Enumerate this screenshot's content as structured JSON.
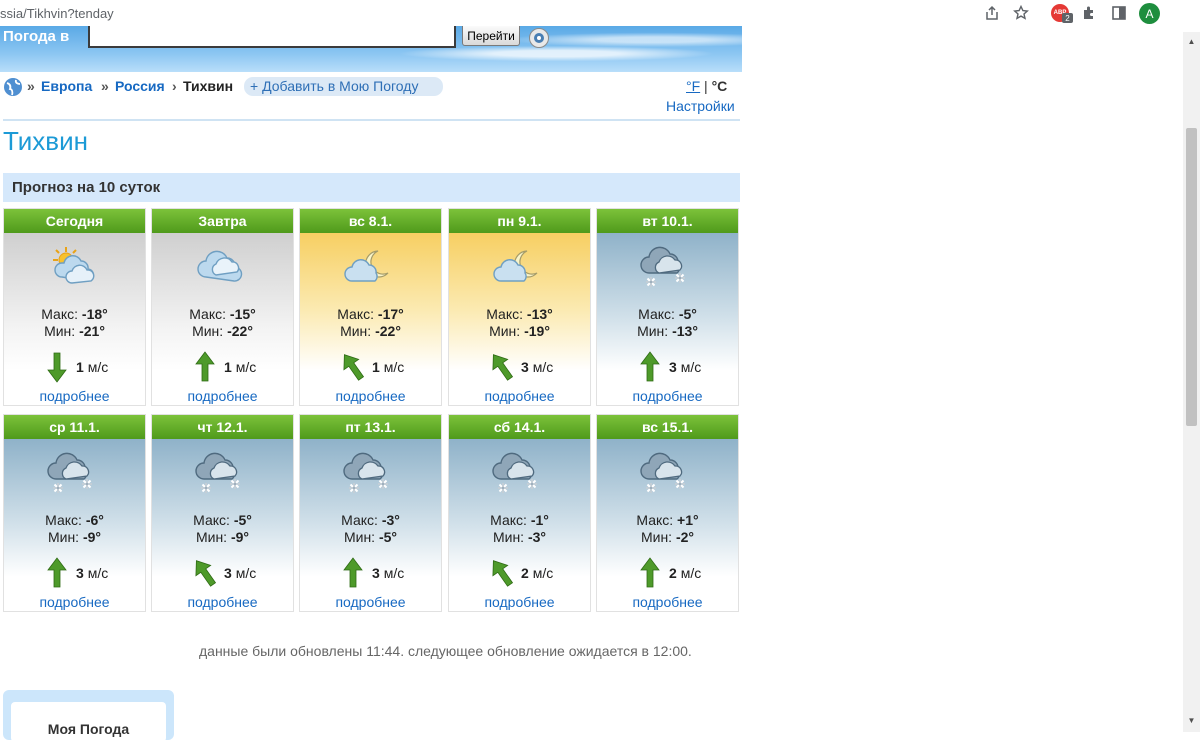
{
  "browser": {
    "url": "ssia/Tikhvin?tenday",
    "extension_badge": "2",
    "extension_label": "ABP",
    "avatar_letter": "A",
    "icons": [
      "share-icon",
      "bookmark-star-icon",
      "adblock-extension-icon",
      "puzzle-extensions-icon",
      "side-panel-icon",
      "profile-avatar"
    ]
  },
  "header": {
    "search_label": "Погода в",
    "search_value": "",
    "go_button": "Перейти"
  },
  "breadcrumb": {
    "items": [
      "Европа",
      "Россия",
      "Тихвин"
    ],
    "add_label": "+ Добавить в Мою Погоду",
    "unit_f": "°F",
    "unit_sep": "|",
    "unit_c": "°C",
    "settings": "Настройки"
  },
  "page_title": "Тихвин",
  "forecast": {
    "heading": "Прогноз на 10 суток",
    "max_label": "Макс:",
    "min_label": "Мин:",
    "more_label": "подробнее",
    "days": [
      {
        "day": "Сегодня",
        "icon": "sun-clouds-icon",
        "max": "-18°",
        "min": "-21°",
        "wind": "1",
        "wind_unit": "м/с",
        "wind_dir": "down",
        "bg": "grey"
      },
      {
        "day": "Завтра",
        "icon": "cloud-icon",
        "max": "-15°",
        "min": "-22°",
        "wind": "1",
        "wind_unit": "м/с",
        "wind_dir": "up",
        "bg": "grey"
      },
      {
        "day": "вс 8.1.",
        "icon": "moon-cloud-icon",
        "max": "-17°",
        "min": "-22°",
        "wind": "1",
        "wind_unit": "м/с",
        "wind_dir": "up-left",
        "bg": "sun"
      },
      {
        "day": "пн 9.1.",
        "icon": "moon-cloud-icon",
        "max": "-13°",
        "min": "-19°",
        "wind": "3",
        "wind_unit": "м/с",
        "wind_dir": "up-left",
        "bg": "sun"
      },
      {
        "day": "вт 10.1.",
        "icon": "snow-cloud-icon",
        "max": "-5°",
        "min": "-13°",
        "wind": "3",
        "wind_unit": "м/с",
        "wind_dir": "up",
        "bg": "blue"
      },
      {
        "day": "ср 11.1.",
        "icon": "snow-cloud-icon",
        "max": "-6°",
        "min": "-9°",
        "wind": "3",
        "wind_unit": "м/с",
        "wind_dir": "up",
        "bg": "blue"
      },
      {
        "day": "чт 12.1.",
        "icon": "snow-cloud-icon",
        "max": "-5°",
        "min": "-9°",
        "wind": "3",
        "wind_unit": "м/с",
        "wind_dir": "up-left",
        "bg": "blue"
      },
      {
        "day": "пт 13.1.",
        "icon": "snow-cloud-icon",
        "max": "-3°",
        "min": "-5°",
        "wind": "3",
        "wind_unit": "м/с",
        "wind_dir": "up",
        "bg": "blue"
      },
      {
        "day": "сб 14.1.",
        "icon": "snow-cloud-icon",
        "max": "-1°",
        "min": "-3°",
        "wind": "2",
        "wind_unit": "м/с",
        "wind_dir": "up-left",
        "bg": "blue"
      },
      {
        "day": "вс 15.1.",
        "icon": "snow-cloud-icon",
        "max": "+1°",
        "min": "-2°",
        "wind": "2",
        "wind_unit": "м/с",
        "wind_dir": "up",
        "bg": "blue"
      }
    ]
  },
  "update_note": "данные были обновлены 11:44. следующее обновление ожидается в 12:00.",
  "my_weather": {
    "title": "Моя Погода"
  }
}
